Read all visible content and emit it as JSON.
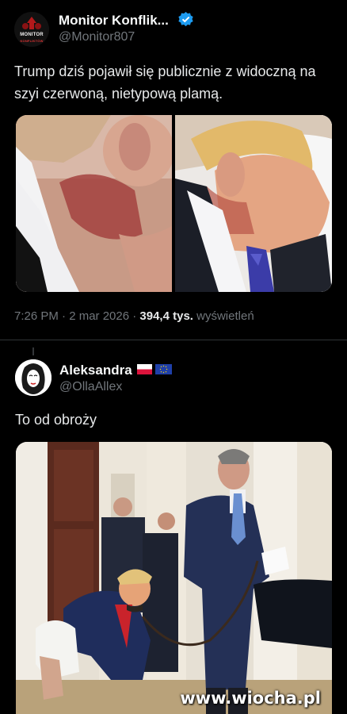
{
  "tweet1": {
    "author_name": "Monitor Konflik...",
    "handle": "@Monitor807",
    "avatar_text": "MONITOR",
    "avatar_subtext": "KONFLIKTÓW",
    "text": "Trump dziś pojawił się publicznie z widoczną na szyi czerwoną, nietypową plamą.",
    "time": "7:26 PM · 2 mar 2026 · ",
    "views_count": "394,4 tys.",
    "views_label": " wyświetleń"
  },
  "tweet2": {
    "author_name": "Aleksandra",
    "handle": "@OllaAllex",
    "text": "To od obroży"
  },
  "watermark": "www.wiocha.pl",
  "colors": {
    "background": "#000000",
    "text": "#e7e9ea",
    "secondary": "#71767b",
    "verified": "#1d9bf0",
    "divider": "#2f3336"
  },
  "icons": [
    "verified-badge-icon",
    "poland-flag-icon",
    "eu-flag-icon"
  ]
}
